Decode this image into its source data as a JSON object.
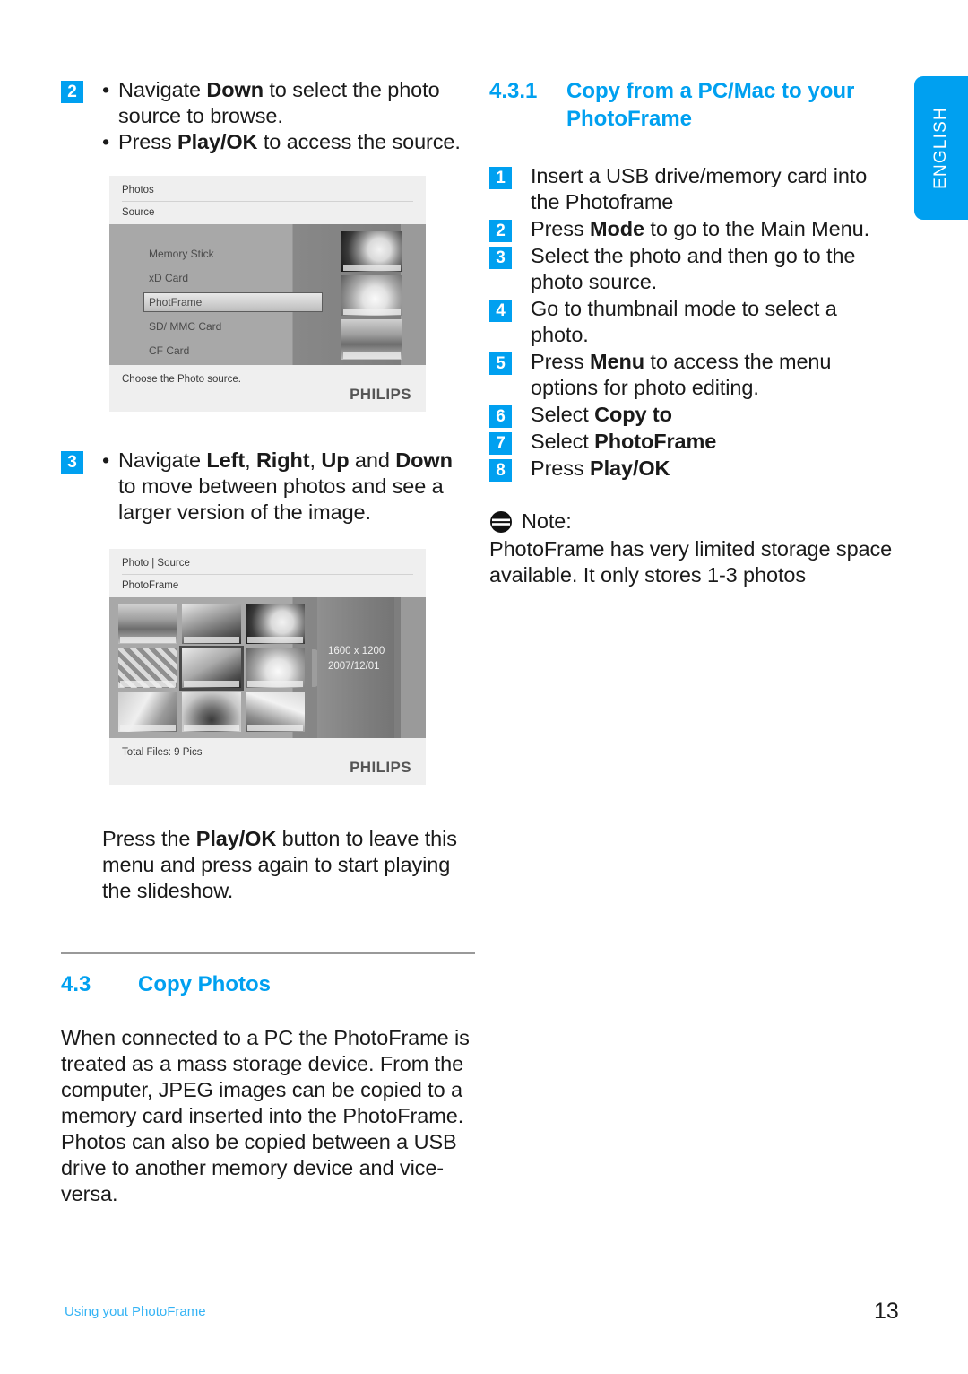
{
  "language_tab": {
    "label": "ENGLISH"
  },
  "accent_color": "#00a0f0",
  "footer": {
    "left_text": "Using yout PhotoFrame",
    "page_number": "13"
  },
  "left_column": {
    "step2": {
      "badge": "2",
      "bullets": [
        {
          "pre": "Navigate ",
          "bold": "Down",
          "post": " to select the photo source to browse."
        },
        {
          "pre": "Press ",
          "bold": "Play/OK",
          "post": " to access the source."
        }
      ]
    },
    "screenshot_source": {
      "header_line1": "Photos",
      "header_line2": "Source",
      "menu_items": [
        "Memory Stick",
        "xD Card",
        "PhotFrame",
        "SD/ MMC Card",
        "CF Card"
      ],
      "selected_item": "PhotFrame",
      "status_text": "Choose the Photo source.",
      "brand": "PHILIPS"
    },
    "step3": {
      "badge": "3",
      "bullet": {
        "pre": "Navigate ",
        "bold1": "Left",
        "mid1": ", ",
        "bold2": "Right",
        "mid2": ", ",
        "bold3": "Up",
        "mid3": " and ",
        "bold4": "Down",
        "post": " to move between photos and see a larger version of the image."
      }
    },
    "screenshot_thumbnails": {
      "header_line1": "Photo | Source",
      "header_line2": "PhotoFrame",
      "info_resolution": "1600 x  1200",
      "info_date": "2007/12/01",
      "status_text": "Total Files: 9 Pics",
      "brand": "PHILIPS"
    },
    "closing_paragraph": {
      "pre": "Press the ",
      "bold": "Play/OK",
      "post": " button to leave this menu and press again to start playing the slideshow."
    },
    "section_4_3": {
      "number": "4.3",
      "title": "Copy Photos",
      "body": "When connected to a PC the PhotoFrame is treated as a mass storage device. From the computer, JPEG images can be copied to a memory card inserted into the PhotoFrame. Photos can also be copied between a USB drive to another memory  device and vice-versa."
    }
  },
  "right_column": {
    "section_4_3_1": {
      "number": "4.3.1",
      "title": "Copy from a PC/Mac to your PhotoFrame"
    },
    "steps": [
      {
        "badge": "1",
        "pre": "Insert a USB drive/memory card into the Photoframe",
        "bold": "",
        "post": ""
      },
      {
        "badge": "2",
        "pre": "Press ",
        "bold": "Mode",
        "post": " to go to the Main Menu."
      },
      {
        "badge": "3",
        "pre": "Select the photo and then go to the photo source.",
        "bold": "",
        "post": ""
      },
      {
        "badge": "4",
        "pre": "Go to thumbnail mode to select a photo.",
        "bold": "",
        "post": ""
      },
      {
        "badge": "5",
        "pre": "Press ",
        "bold": "Menu",
        "post": " to access the menu options for photo editing."
      },
      {
        "badge": "6",
        "pre": "Select ",
        "bold": "Copy to",
        "post": ""
      },
      {
        "badge": "7",
        "pre": "Select ",
        "bold": "PhotoFrame",
        "post": ""
      },
      {
        "badge": "8",
        "pre": "Press ",
        "bold": "Play/OK",
        "post": ""
      }
    ],
    "note": {
      "label": "Note:",
      "body": "PhotoFrame has very limited storage space available. It only stores 1-3 photos"
    }
  }
}
